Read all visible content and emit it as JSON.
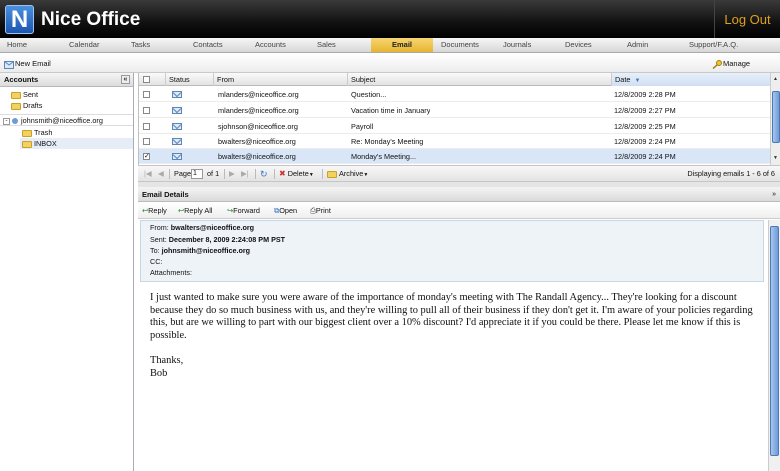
{
  "app": {
    "logo_letter": "N",
    "title": "Nice Office",
    "logout": "Log Out"
  },
  "nav": {
    "items": [
      "Home",
      "Calendar",
      "Tasks",
      "Contacts",
      "Accounts",
      "Sales",
      "Email",
      "Documents",
      "Journals",
      "Devices",
      "Admin",
      "Support/F.A.Q."
    ],
    "active": "Email"
  },
  "toolbar": {
    "new_email": "New Email",
    "manage_accounts": "Manage Accounts"
  },
  "sidebar": {
    "header": "Accounts",
    "collapse_glyph": "«",
    "top_folders": [
      "Sent",
      "Drafts"
    ],
    "account": "johnsmith@niceoffice.org",
    "account_folders": [
      "Trash",
      "INBOX"
    ],
    "selected_folder": "INBOX"
  },
  "grid": {
    "headers": {
      "status": "Status",
      "from": "From",
      "subject": "Subject",
      "date": "Date"
    },
    "sort": {
      "column": "Date",
      "direction": "descending"
    },
    "rows": [
      {
        "from": "mlanders@niceoffice.org",
        "subject": "Question...",
        "date": "12/8/2009 2:28 PM",
        "checked": false
      },
      {
        "from": "mlanders@niceoffice.org",
        "subject": "Vacation time in January",
        "date": "12/8/2009 2:27 PM",
        "checked": false
      },
      {
        "from": "sjohnson@niceoffice.org",
        "subject": "Payroll",
        "date": "12/8/2009 2:25 PM",
        "checked": false
      },
      {
        "from": "bwalters@niceoffice.org",
        "subject": "Re: Monday's Meeting",
        "date": "12/8/2009 2:24 PM",
        "checked": false
      },
      {
        "from": "bwalters@niceoffice.org",
        "subject": "Monday's Meeting...",
        "date": "12/8/2009 2:24 PM",
        "checked": true
      }
    ]
  },
  "pager": {
    "page_label": "Page",
    "page_value": "1",
    "of_label": "of 1",
    "delete": "Delete",
    "archive": "Archive",
    "summary": "Displaying emails 1 - 6 of 6"
  },
  "details": {
    "header": "Email Details",
    "actions": {
      "reply": "Reply",
      "reply_all": "Reply All",
      "forward": "Forward",
      "open": "Open",
      "print": "Print"
    },
    "from_label": "From:",
    "from": "bwalters@niceoffice.org",
    "sent_label": "Sent:",
    "sent": "December 8, 2009 2:24:08 PM PST",
    "to_label": "To:",
    "to": "johnsmith@niceoffice.org",
    "cc_label": "CC:",
    "attachments_label": "Attachments:",
    "body": "I just wanted to make sure you were aware of the importance of monday's meeting with The Randall Agency... They're looking for a discount because they do so much business with us, and they're willing to pull all of their business if they don't get it. I'm aware of your policies regarding this, but are we willing to part with our biggest client over a 10% discount? I'd appreciate it if you could be there. Please let me know if this is possible.",
    "signoff": "Thanks,",
    "signature": "Bob"
  },
  "colors": {
    "accent": "#e6b530",
    "logout": "#e0a020",
    "selection": "#d9e6f7",
    "header_bg": "#111111"
  }
}
